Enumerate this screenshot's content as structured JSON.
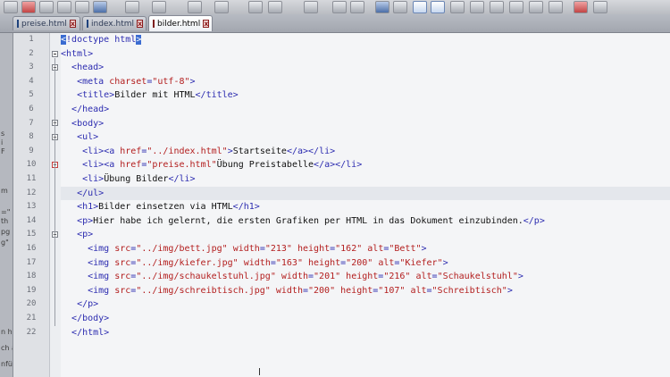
{
  "tabs": [
    {
      "label": "preise.html",
      "active": false
    },
    {
      "label": "index.html",
      "active": false
    },
    {
      "label": "bilder.html",
      "active": true
    }
  ],
  "side_fragments": [
    "s",
    "i",
    "F",
    "m",
    "=\"",
    "th",
    "pg",
    "g\"",
    "n hä",
    "ch a",
    "nfüh"
  ],
  "code_lines": [
    {
      "n": "1"
    },
    {
      "n": "2"
    },
    {
      "n": "3"
    },
    {
      "n": "4"
    },
    {
      "n": "5"
    },
    {
      "n": "6"
    },
    {
      "n": "7"
    },
    {
      "n": "8"
    },
    {
      "n": "9"
    },
    {
      "n": "10"
    },
    {
      "n": "11"
    },
    {
      "n": "12"
    },
    {
      "n": "13"
    },
    {
      "n": "14"
    },
    {
      "n": "15"
    },
    {
      "n": "16"
    },
    {
      "n": "17"
    },
    {
      "n": "18"
    },
    {
      "n": "19"
    },
    {
      "n": "20"
    },
    {
      "n": "21"
    },
    {
      "n": "22"
    }
  ],
  "code": {
    "l1": {
      "open": "<",
      "rest": "!doctype html",
      "close": ">"
    },
    "l2": "<html>",
    "l3": "<head>",
    "l4": {
      "tag": "<meta ",
      "attr": "charset",
      "eq": "=",
      "val": "\"utf-8\"",
      "end": ">"
    },
    "l5": {
      "open": "<title>",
      "text": "Bilder mit HTML",
      "close": "</title>"
    },
    "l6": "</head>",
    "l7": "<body>",
    "l8": "<ul>",
    "l9": {
      "li": "<li>",
      "a": "<a ",
      "attr": "href",
      "eq": "=",
      "val": "\"../index.html\"",
      "gt": ">",
      "text": "Startseite",
      "ca": "</a>",
      "cli": "</li>"
    },
    "l10": {
      "li": "<li>",
      "a": "<a ",
      "attr": "href",
      "eq": "=",
      "val": "\"preise.html\"",
      "text": "Übung Preistabelle",
      "ca": "</a>",
      "cli": "</li>"
    },
    "l11": {
      "li": "<li>",
      "text": "Übung Bilder",
      "cli": "</li>"
    },
    "l12": "</ul>",
    "l13": {
      "open": "<h1>",
      "text": "Bilder einsetzen via HTML",
      "close": "</h1>"
    },
    "l14": {
      "open": "<p>",
      "text": "Hier habe ich gelernt, die ersten Grafiken per HTML in das Dokument einzubinden.",
      "close": "</p>"
    },
    "l15": "<p>",
    "images": [
      {
        "src": "\"../img/bett.jpg\"",
        "width": "\"213\"",
        "height": "\"162\"",
        "alt": "\"Bett\""
      },
      {
        "src": "\"../img/kiefer.jpg\"",
        "width": "\"163\"",
        "height": "\"200\"",
        "alt": "\"Kiefer\""
      },
      {
        "src": "\"../img/schaukelstuhl.jpg\"",
        "width": "\"201\"",
        "height": "\"216\"",
        "alt": "\"Schaukelstuhl\""
      },
      {
        "src": "\"../img/schreibtisch.jpg\"",
        "width": "\"200\"",
        "height": "\"107\"",
        "alt": "\"Schreibtisch\""
      }
    ],
    "img_tag": "<img ",
    "attr_src": "src",
    "attr_width": "width",
    "attr_height": "height",
    "attr_alt": "alt",
    "eq": "=",
    "img_end": ">",
    "l20": "</p>",
    "l21": "</body>",
    "l22": "</html>"
  }
}
